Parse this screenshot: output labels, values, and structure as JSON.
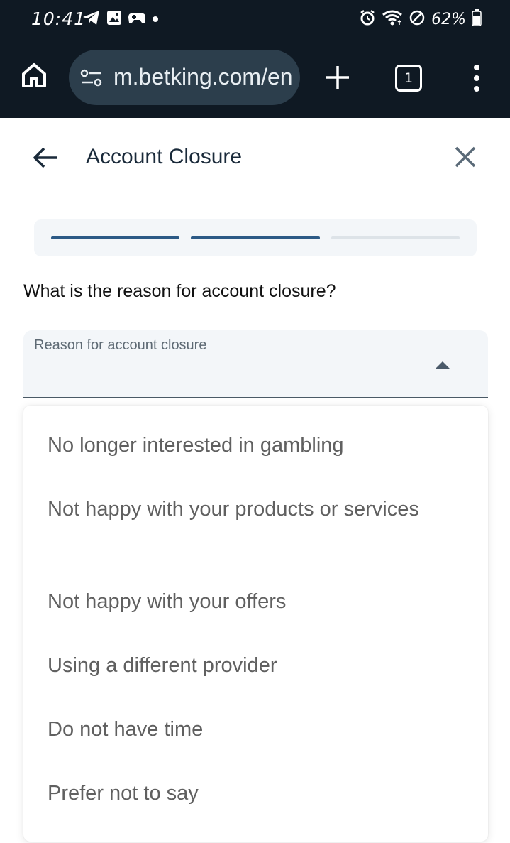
{
  "status_bar": {
    "time": "10:41",
    "battery_percent": "62%",
    "left_icons": [
      "telegram-icon",
      "gallery-icon",
      "game-controller-icon",
      "dot-icon"
    ],
    "right_icons": [
      "alarm-icon",
      "wifi-icon",
      "do-not-disturb-icon",
      "battery-icon"
    ]
  },
  "browser": {
    "url": "m.betking.com/en",
    "tab_count": "1",
    "icons": [
      "home-icon",
      "site-settings-icon",
      "plus-icon",
      "tabs-icon",
      "more-vert-icon"
    ]
  },
  "header": {
    "title": "Account Closure"
  },
  "progress": {
    "total_steps": 3,
    "completed_steps": 2,
    "active_color": "#2c5a86",
    "inactive_color": "#dde3e8"
  },
  "form": {
    "question": "What is the reason for account closure?",
    "select_label": "Reason for account closure",
    "selected_value": ""
  },
  "dropdown": {
    "options": [
      "No longer interested in gambling",
      "Not happy with your products or services",
      "Not happy with your offers",
      "Using a different provider",
      "Do not have time",
      "Prefer not to say"
    ]
  },
  "colors": {
    "browser_bg": "#0f1923",
    "url_pill": "#2c3e4c",
    "field_bg": "#f3f6f9",
    "option_text": "#606060"
  }
}
